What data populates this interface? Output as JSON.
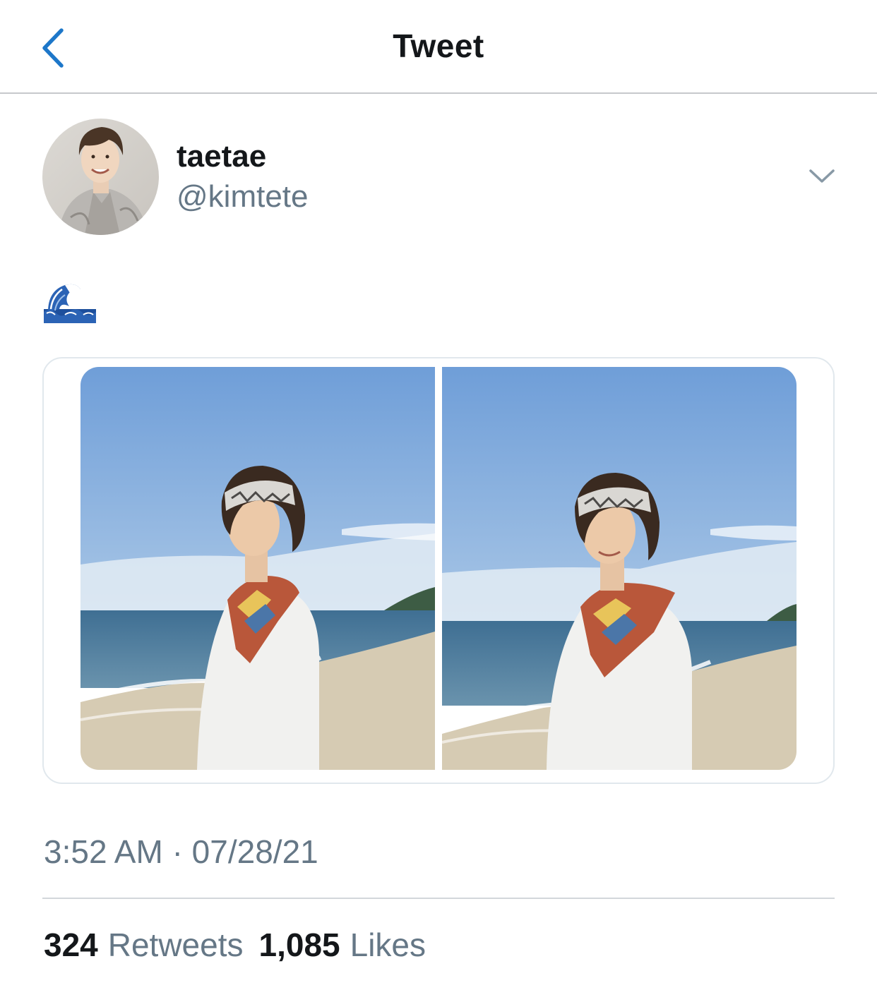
{
  "header": {
    "title": "Tweet",
    "back_icon": "chevron-left-icon"
  },
  "colors": {
    "accent": "#1d77c9",
    "text_primary": "#14171a",
    "text_secondary": "#657786",
    "divider": "#d3d7db"
  },
  "author": {
    "display_name": "taetae",
    "handle": "@kimtete",
    "avatar": "profile photo",
    "menu_icon": "chevron-down-icon"
  },
  "tweet": {
    "emoji": "🌊",
    "media": [
      {
        "description": "man with patterned bandana on beach, looking at camera"
      },
      {
        "description": "man with patterned bandana on beach, smiling"
      }
    ]
  },
  "meta": {
    "time": "3:52 AM",
    "separator": "·",
    "date": "07/28/21"
  },
  "stats": {
    "retweets_count": "324",
    "retweets_label": "Retweets",
    "likes_count": "1,085",
    "likes_label": "Likes"
  }
}
